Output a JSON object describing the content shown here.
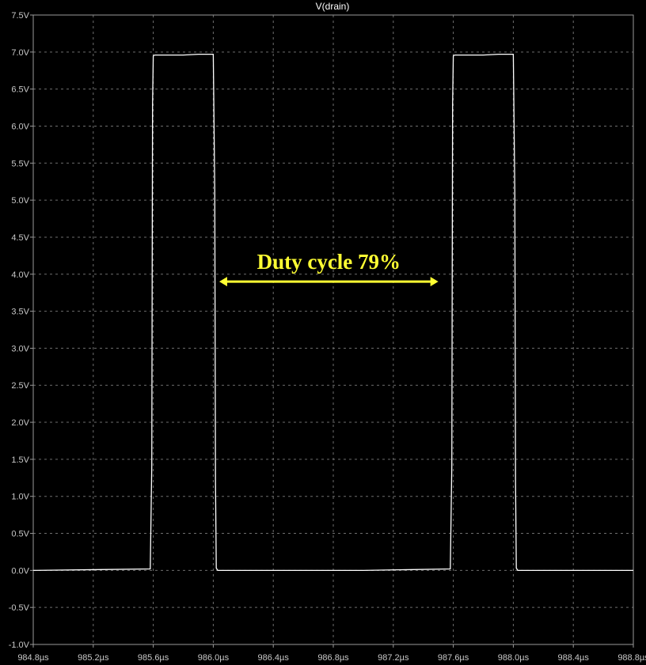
{
  "chart_data": {
    "type": "line",
    "title": "V(drain)",
    "xlabel": "",
    "ylabel": "",
    "xlim": [
      984.8,
      988.8
    ],
    "ylim": [
      -1.0,
      7.5
    ],
    "grid": true,
    "x_unit": "µs",
    "y_unit": "V",
    "x_ticks": [
      "984.8µs",
      "985.2µs",
      "985.6µs",
      "986.0µs",
      "986.4µs",
      "986.8µs",
      "987.2µs",
      "987.6µs",
      "988.0µs",
      "988.4µs",
      "988.8µs"
    ],
    "x_tick_values": [
      984.8,
      985.2,
      985.6,
      986.0,
      986.4,
      986.8,
      987.2,
      987.6,
      988.0,
      988.4,
      988.8
    ],
    "y_ticks": [
      "7.5V",
      "7.0V",
      "6.5V",
      "6.0V",
      "5.5V",
      "5.0V",
      "4.5V",
      "4.0V",
      "3.5V",
      "3.0V",
      "2.5V",
      "2.0V",
      "1.5V",
      "1.0V",
      "0.5V",
      "0.0V",
      "-0.5V",
      "-1.0V"
    ],
    "y_tick_values": [
      7.5,
      7.0,
      6.5,
      6.0,
      5.5,
      5.0,
      4.5,
      4.0,
      3.5,
      3.0,
      2.5,
      2.0,
      1.5,
      1.0,
      0.5,
      0.0,
      -0.5,
      -1.0
    ],
    "series": [
      {
        "color": "#ffffff",
        "x": [
          984.8,
          985.58,
          985.59,
          985.595,
          985.6,
          985.61,
          985.62,
          985.8,
          985.9,
          986.0,
          986.01,
          986.015,
          986.02,
          986.03,
          986.2,
          987.0,
          987.58,
          987.59,
          987.595,
          987.6,
          987.61,
          987.62,
          987.8,
          987.9,
          988.0,
          988.01,
          988.015,
          988.02,
          988.03,
          988.8
        ],
        "values": [
          0.0,
          0.02,
          1.4,
          6.3,
          6.95,
          6.96,
          6.96,
          6.96,
          6.97,
          6.97,
          5.1,
          1.2,
          0.03,
          0.0,
          0.0,
          0.0,
          0.02,
          1.4,
          6.3,
          6.95,
          6.96,
          6.96,
          6.96,
          6.97,
          6.97,
          5.1,
          1.2,
          0.03,
          0.0,
          0.0
        ]
      }
    ],
    "annotation": {
      "text": "Duty cycle 79%",
      "color": "#ffff33",
      "arrow_from": 986.04,
      "arrow_to": 987.5,
      "arrow_y": 3.9,
      "text_y": 4.17
    }
  }
}
